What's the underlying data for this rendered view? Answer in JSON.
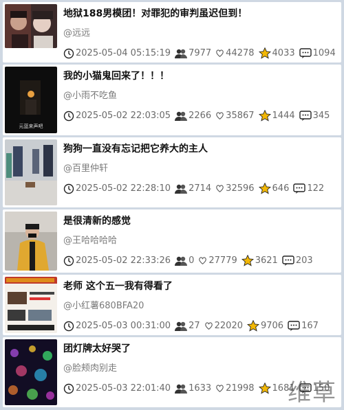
{
  "posts": [
    {
      "title": "地狱188男模团！对罪犯的审判虽迟但到！",
      "author": "@远远",
      "date": "2025-05-04 05:15:19",
      "views": "7977",
      "likes": "44278",
      "stars": "4033",
      "comments": "1094"
    },
    {
      "title": "我的小猫鬼回来了！！！",
      "author": "@小雨不吃鱼",
      "date": "2025-05-02 22:03:05",
      "views": "2266",
      "likes": "35867",
      "stars": "1444",
      "comments": "345",
      "thumb_caption": "元蓝来声吧"
    },
    {
      "title": "狗狗一直没有忘记把它养大的主人",
      "author": "@百里仲轩",
      "date": "2025-05-02 22:28:10",
      "views": "2714",
      "likes": "32596",
      "stars": "646",
      "comments": "122"
    },
    {
      "title": "是很清新的感觉",
      "author": "@王哈哈哈哈",
      "date": "2025-05-02 22:33:26",
      "views": "0",
      "likes": "27779",
      "stars": "3621",
      "comments": "203"
    },
    {
      "title": "老师 这个五一我有得看了",
      "author": "@小红薯680BFA20",
      "date": "2025-05-03 00:31:00",
      "views": "27",
      "likes": "22020",
      "stars": "9706",
      "comments": "167"
    },
    {
      "title": "团灯牌太好哭了",
      "author": "@脸颊肉别走",
      "date": "2025-05-03 22:01:40",
      "views": "1633",
      "likes": "21998",
      "stars": "1681",
      "comments": "150"
    }
  ],
  "watermark": "维草",
  "colors": {
    "background": "#cfd8e3",
    "card": "#ffffff",
    "star": "#f2b705",
    "meta_text": "#6a6a6a"
  }
}
